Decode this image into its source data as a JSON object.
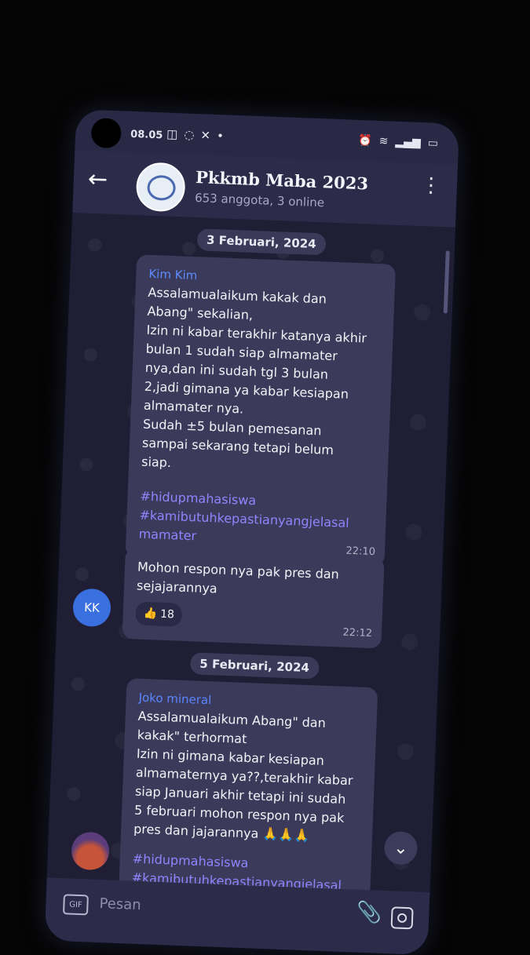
{
  "status_bar": {
    "time": "08.05",
    "left_icons": [
      "instagram-icon",
      "whatsapp-icon",
      "x-icon",
      "dot-icon"
    ],
    "right_icons": [
      "alarm-icon",
      "wifi-icon",
      "signal-icon",
      "battery-icon"
    ]
  },
  "header": {
    "title": "Pkkmb Maba 2023",
    "subtitle": "653 anggota, 3 online"
  },
  "messages": [
    {
      "date": "3 Februari, 2024",
      "sender": "Kim Kim",
      "lines": [
        "Assalamualaikum kakak dan",
        "Abang\" sekalian,",
        "Izin ni kabar terakhir katanya akhir",
        "bulan 1 sudah siap almamater",
        "nya,dan ini sudah tgl 3 bulan",
        "2,jadi gimana ya kabar kesiapan",
        "almamater nya.",
        "Sudah ±5 bulan pemesanan",
        "sampai sekarang tetapi belum",
        "siap."
      ],
      "hashtags": [
        "#hidupmahasiswa",
        "#kamibutuhkepastianyangjelasal",
        "mamater"
      ],
      "time": "22:10"
    },
    {
      "text": "Mohon respon nya pak pres dan sejajarannya",
      "reaction": {
        "emoji": "👍",
        "count": "18"
      },
      "avatar_initials": "KK",
      "time": "22:12"
    },
    {
      "date": "5 Februari, 2024",
      "sender": "Joko mineral",
      "lines": [
        "Assalamualaikum Abang\" dan",
        "kakak\" terhormat",
        "Izin ni gimana kabar kesiapan",
        "almamaternya ya??,terakhir kabar",
        "siap Januari akhir tetapi ini sudah",
        "5 februari mohon respon nya pak",
        "pres dan jajarannya 🙏🙏🙏"
      ],
      "hashtags": [
        "#hidupmahasiswa",
        "#kamibutuhkepastianyangjelasal"
      ]
    }
  ],
  "input": {
    "placeholder": "Pesan"
  },
  "colors": {
    "background": "#1f1e35",
    "bubble": "#3b3a5a",
    "accent": "#5d8bff",
    "hashtag": "#8e86ff"
  }
}
